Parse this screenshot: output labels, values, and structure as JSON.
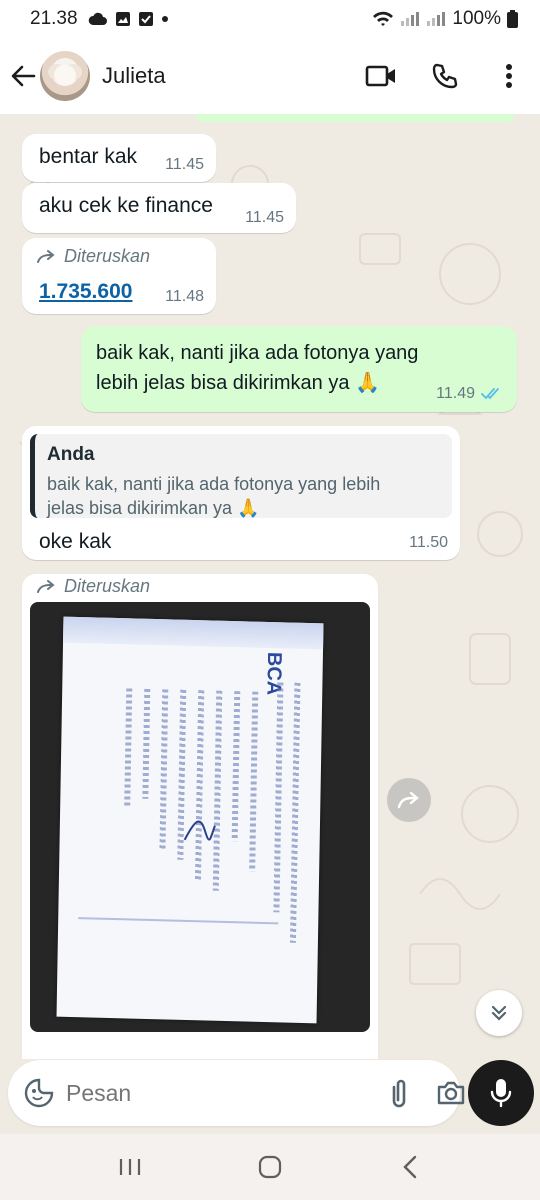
{
  "status": {
    "time": "21.38",
    "battery": "100%"
  },
  "header": {
    "contact_name": "Julieta"
  },
  "messages": [
    {
      "dir": "in",
      "text": "bentar kak",
      "time": "11.45"
    },
    {
      "dir": "in",
      "text": "aku cek ke finance",
      "time": "11.45"
    },
    {
      "dir": "in",
      "forwarded_label": "Diteruskan",
      "link": "1.735.600",
      "time": "11.48"
    },
    {
      "dir": "out",
      "text_line1": "baik kak, nanti jika ada fotonya yang",
      "text_line2": "lebih jelas bisa dikirimkan ya",
      "emoji": "🙏",
      "time": "11.49"
    },
    {
      "dir": "in",
      "quote_name": "Anda",
      "quote_line1": "baik kak, nanti jika ada fotonya yang lebih",
      "quote_line2": "jelas bisa dikirimkan ya",
      "quote_emoji": "🙏",
      "text": "oke kak",
      "time": "11.50"
    },
    {
      "dir": "in",
      "forwarded_label": "Diteruskan",
      "image": "receipt-photo"
    }
  ],
  "receipt_photo": {
    "brand": "BCA"
  },
  "composer": {
    "placeholder": "Pesan"
  },
  "icons": [
    "back-arrow-icon",
    "video-call-icon",
    "phone-icon",
    "more-vert-icon",
    "sticker-icon",
    "attach-icon",
    "camera-icon",
    "mic-icon",
    "forward-icon",
    "scroll-down-icon"
  ],
  "colors": {
    "outgoing_bubble": "#d9fdd3",
    "incoming_bubble": "#ffffff",
    "chat_bg": "#efeae2",
    "link": "#0b63a6",
    "read_ticks": "#53bdeb"
  }
}
